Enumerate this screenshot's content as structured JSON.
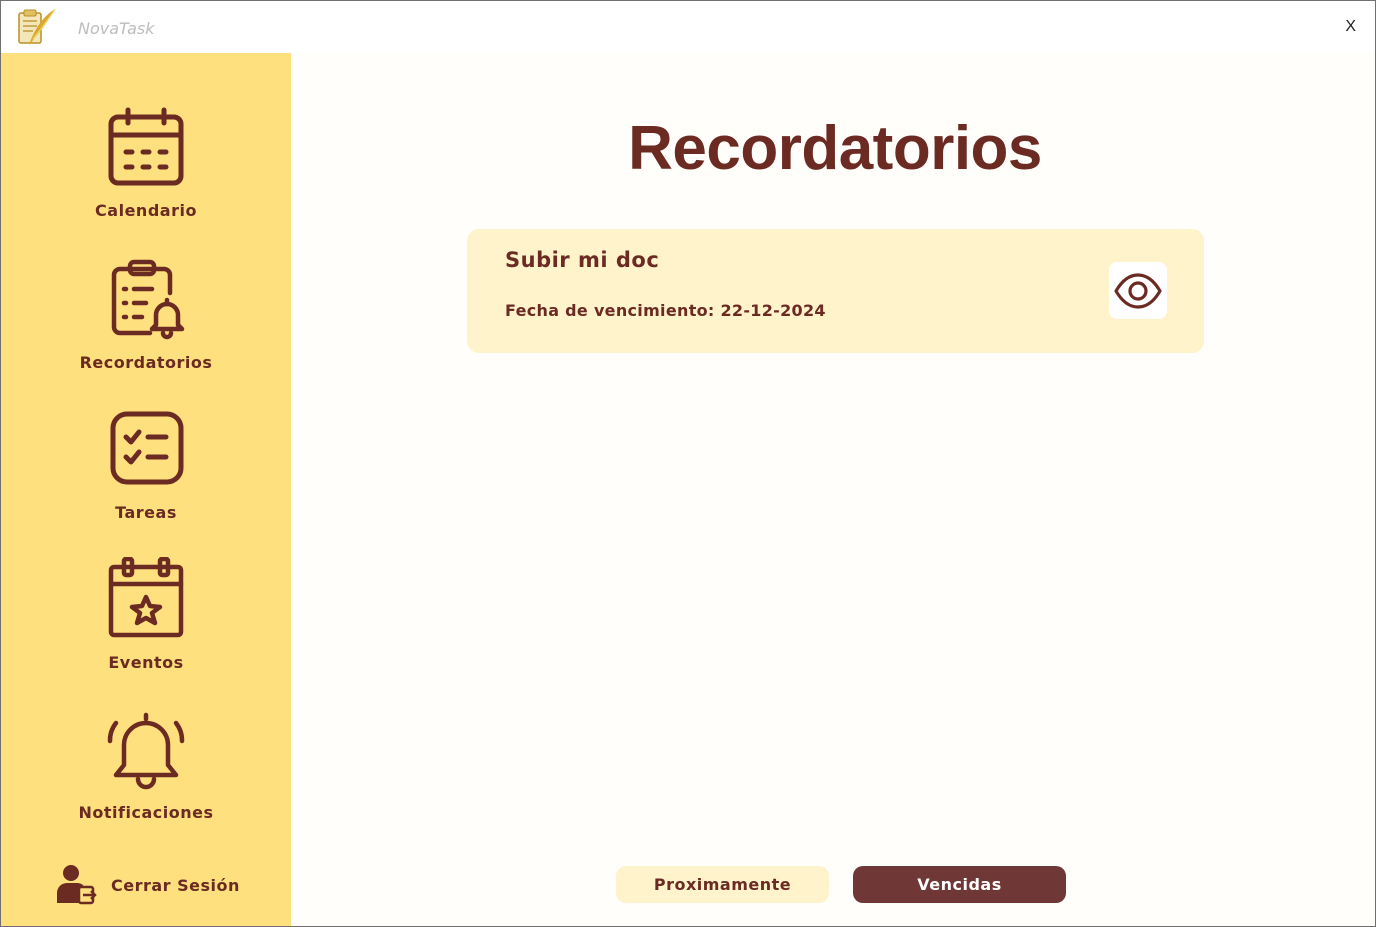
{
  "app": {
    "title": "NovaTask",
    "close_label": "X"
  },
  "sidebar": {
    "items": [
      {
        "label": "Calendario",
        "icon": "calendar-icon"
      },
      {
        "label": "Recordatorios",
        "icon": "clipboard-bell-icon"
      },
      {
        "label": "Tareas",
        "icon": "checklist-icon"
      },
      {
        "label": "Eventos",
        "icon": "calendar-star-icon"
      },
      {
        "label": "Notificaciones",
        "icon": "bell-icon"
      }
    ],
    "logout": {
      "label": "Cerrar Sesión",
      "icon": "user-logout-icon"
    }
  },
  "main": {
    "title": "Recordatorios",
    "reminders": [
      {
        "title": "Subir mi doc",
        "due": "Fecha de vencimiento: 22-12-2024",
        "action_icon": "eye-icon"
      }
    ],
    "tabs": [
      {
        "label": "Proximamente",
        "active": false
      },
      {
        "label": "Vencidas",
        "active": true
      }
    ]
  },
  "colors": {
    "sidebar": "#ffe07e",
    "primary_text": "#6b2a22",
    "card": "#fff3cc",
    "active_tab": "#6f3836"
  }
}
